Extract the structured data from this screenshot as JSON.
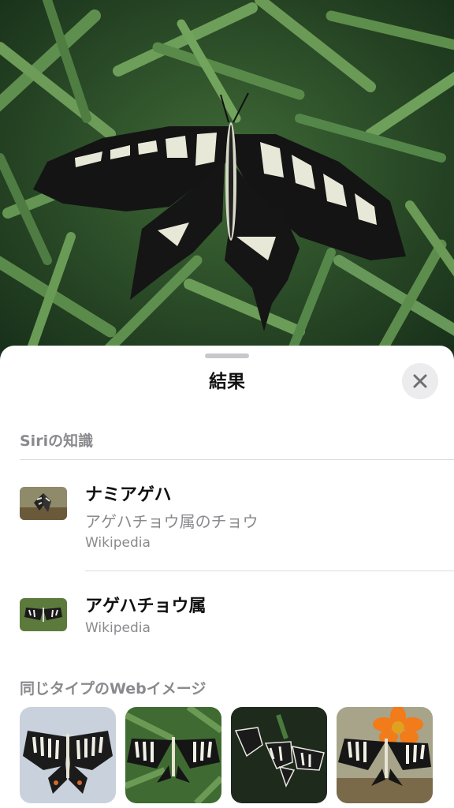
{
  "sheet": {
    "title": "結果",
    "close_icon": "xmark-icon"
  },
  "siri_knowledge": {
    "header": "Siriの知識",
    "items": [
      {
        "title": "ナミアゲハ",
        "subtitle": "アゲハチョウ属のチョウ",
        "source": "Wikipedia"
      },
      {
        "title": "アゲハチョウ属",
        "source": "Wikipedia"
      }
    ]
  },
  "web_images": {
    "header": "同じタイプのWebイメージ",
    "count": 4
  },
  "colors": {
    "sheet_bg": "#ffffff",
    "secondary_text": "#8a8a8e",
    "close_button_bg": "#ececee"
  }
}
